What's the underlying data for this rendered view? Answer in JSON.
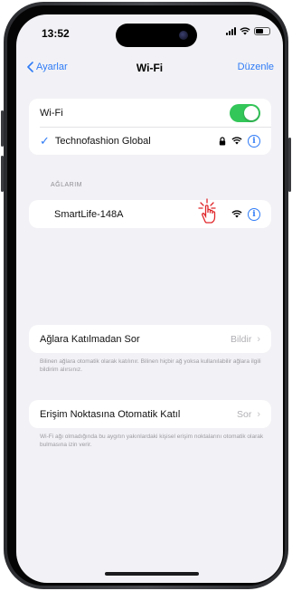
{
  "status_bar": {
    "time": "13:52"
  },
  "nav": {
    "back_label": "Ayarlar",
    "title": "Wi-Fi",
    "edit_label": "Düzenle"
  },
  "wifi_toggle": {
    "label": "Wi-Fi",
    "on": true
  },
  "connected_network": {
    "name": "Technofashion Global",
    "secured": true
  },
  "networks": {
    "header": "AĞLARIM",
    "items": [
      {
        "name": "SmartLife-148A",
        "secured": false
      }
    ]
  },
  "ask_to_join": {
    "label": "Ağlara Katılmadan Sor",
    "value": "Bildir",
    "footer": "Bilinen ağlara otomatik olarak katılınır. Bilinen hiçbir ağ yoksa kullanılabilir ağlara ilgili bildirim alırsınız."
  },
  "auto_join_hotspot": {
    "label": "Erişim Noktasına Otomatik Katıl",
    "value": "Sor",
    "footer": "Wi-Fi ağı olmadığında bu aygıtın yakınlardaki kişisel erişim noktalarını otomatik olarak bulmasına izin verir."
  },
  "colors": {
    "accent": "#2f7bf6",
    "toggle_on": "#33c659",
    "pointer": "#e0272b"
  }
}
